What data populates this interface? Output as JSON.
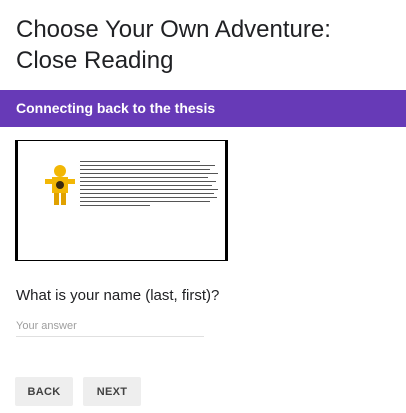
{
  "form": {
    "title": "Choose Your Own Adventure: Close Reading"
  },
  "section": {
    "title": "Connecting back to the thesis"
  },
  "question": {
    "label": "What is your name (last, first)?",
    "placeholder": "Your answer",
    "value": ""
  },
  "navigation": {
    "back_label": "BACK",
    "next_label": "NEXT"
  },
  "colors": {
    "accent": "#673ab7",
    "button_bg": "#eeeeee"
  },
  "icons": {
    "document_image": "document-page-icon"
  }
}
